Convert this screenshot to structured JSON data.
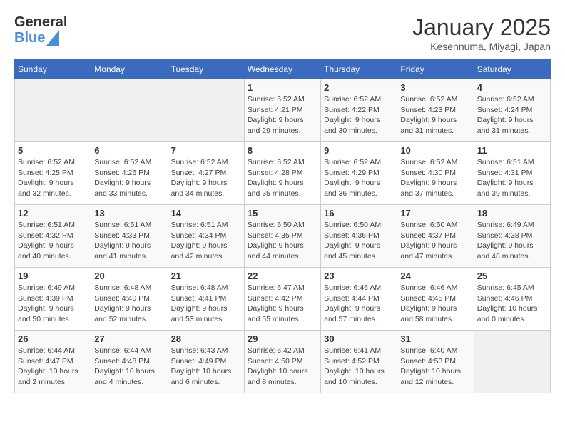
{
  "header": {
    "logo_text_general": "General",
    "logo_text_blue": "Blue",
    "title": "January 2025",
    "location": "Kesennuma, Miyagi, Japan"
  },
  "calendar": {
    "days_of_week": [
      "Sunday",
      "Monday",
      "Tuesday",
      "Wednesday",
      "Thursday",
      "Friday",
      "Saturday"
    ],
    "weeks": [
      [
        {
          "day": "",
          "info": ""
        },
        {
          "day": "",
          "info": ""
        },
        {
          "day": "",
          "info": ""
        },
        {
          "day": "1",
          "info": "Sunrise: 6:52 AM\nSunset: 4:21 PM\nDaylight: 9 hours and 29 minutes."
        },
        {
          "day": "2",
          "info": "Sunrise: 6:52 AM\nSunset: 4:22 PM\nDaylight: 9 hours and 30 minutes."
        },
        {
          "day": "3",
          "info": "Sunrise: 6:52 AM\nSunset: 4:23 PM\nDaylight: 9 hours and 31 minutes."
        },
        {
          "day": "4",
          "info": "Sunrise: 6:52 AM\nSunset: 4:24 PM\nDaylight: 9 hours and 31 minutes."
        }
      ],
      [
        {
          "day": "5",
          "info": "Sunrise: 6:52 AM\nSunset: 4:25 PM\nDaylight: 9 hours and 32 minutes."
        },
        {
          "day": "6",
          "info": "Sunrise: 6:52 AM\nSunset: 4:26 PM\nDaylight: 9 hours and 33 minutes."
        },
        {
          "day": "7",
          "info": "Sunrise: 6:52 AM\nSunset: 4:27 PM\nDaylight: 9 hours and 34 minutes."
        },
        {
          "day": "8",
          "info": "Sunrise: 6:52 AM\nSunset: 4:28 PM\nDaylight: 9 hours and 35 minutes."
        },
        {
          "day": "9",
          "info": "Sunrise: 6:52 AM\nSunset: 4:29 PM\nDaylight: 9 hours and 36 minutes."
        },
        {
          "day": "10",
          "info": "Sunrise: 6:52 AM\nSunset: 4:30 PM\nDaylight: 9 hours and 37 minutes."
        },
        {
          "day": "11",
          "info": "Sunrise: 6:51 AM\nSunset: 4:31 PM\nDaylight: 9 hours and 39 minutes."
        }
      ],
      [
        {
          "day": "12",
          "info": "Sunrise: 6:51 AM\nSunset: 4:32 PM\nDaylight: 9 hours and 40 minutes."
        },
        {
          "day": "13",
          "info": "Sunrise: 6:51 AM\nSunset: 4:33 PM\nDaylight: 9 hours and 41 minutes."
        },
        {
          "day": "14",
          "info": "Sunrise: 6:51 AM\nSunset: 4:34 PM\nDaylight: 9 hours and 42 minutes."
        },
        {
          "day": "15",
          "info": "Sunrise: 6:50 AM\nSunset: 4:35 PM\nDaylight: 9 hours and 44 minutes."
        },
        {
          "day": "16",
          "info": "Sunrise: 6:50 AM\nSunset: 4:36 PM\nDaylight: 9 hours and 45 minutes."
        },
        {
          "day": "17",
          "info": "Sunrise: 6:50 AM\nSunset: 4:37 PM\nDaylight: 9 hours and 47 minutes."
        },
        {
          "day": "18",
          "info": "Sunrise: 6:49 AM\nSunset: 4:38 PM\nDaylight: 9 hours and 48 minutes."
        }
      ],
      [
        {
          "day": "19",
          "info": "Sunrise: 6:49 AM\nSunset: 4:39 PM\nDaylight: 9 hours and 50 minutes."
        },
        {
          "day": "20",
          "info": "Sunrise: 6:48 AM\nSunset: 4:40 PM\nDaylight: 9 hours and 52 minutes."
        },
        {
          "day": "21",
          "info": "Sunrise: 6:48 AM\nSunset: 4:41 PM\nDaylight: 9 hours and 53 minutes."
        },
        {
          "day": "22",
          "info": "Sunrise: 6:47 AM\nSunset: 4:42 PM\nDaylight: 9 hours and 55 minutes."
        },
        {
          "day": "23",
          "info": "Sunrise: 6:46 AM\nSunset: 4:44 PM\nDaylight: 9 hours and 57 minutes."
        },
        {
          "day": "24",
          "info": "Sunrise: 6:46 AM\nSunset: 4:45 PM\nDaylight: 9 hours and 58 minutes."
        },
        {
          "day": "25",
          "info": "Sunrise: 6:45 AM\nSunset: 4:46 PM\nDaylight: 10 hours and 0 minutes."
        }
      ],
      [
        {
          "day": "26",
          "info": "Sunrise: 6:44 AM\nSunset: 4:47 PM\nDaylight: 10 hours and 2 minutes."
        },
        {
          "day": "27",
          "info": "Sunrise: 6:44 AM\nSunset: 4:48 PM\nDaylight: 10 hours and 4 minutes."
        },
        {
          "day": "28",
          "info": "Sunrise: 6:43 AM\nSunset: 4:49 PM\nDaylight: 10 hours and 6 minutes."
        },
        {
          "day": "29",
          "info": "Sunrise: 6:42 AM\nSunset: 4:50 PM\nDaylight: 10 hours and 8 minutes."
        },
        {
          "day": "30",
          "info": "Sunrise: 6:41 AM\nSunset: 4:52 PM\nDaylight: 10 hours and 10 minutes."
        },
        {
          "day": "31",
          "info": "Sunrise: 6:40 AM\nSunset: 4:53 PM\nDaylight: 10 hours and 12 minutes."
        },
        {
          "day": "",
          "info": ""
        }
      ]
    ]
  }
}
